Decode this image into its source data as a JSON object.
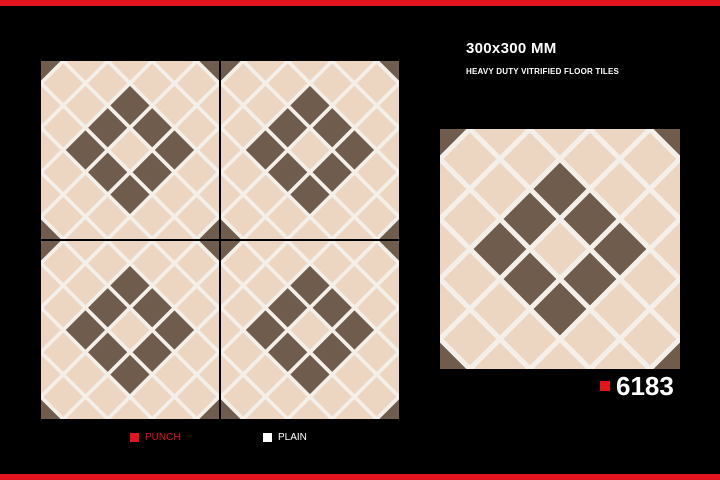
{
  "product": {
    "size": "300x300 MM",
    "description": "HEAVY DUTY VITRIFIED FLOOR TILES",
    "code": "6183"
  },
  "legend": {
    "punch_label": "PUNCH",
    "plain_label": "PLAIN"
  },
  "colors": {
    "accent_red": "#e3141b",
    "tile_dark": "#6f5c4d",
    "tile_light": "#ecd6c2",
    "grout": "#f4efe8",
    "plain_white": "#ffffff"
  }
}
